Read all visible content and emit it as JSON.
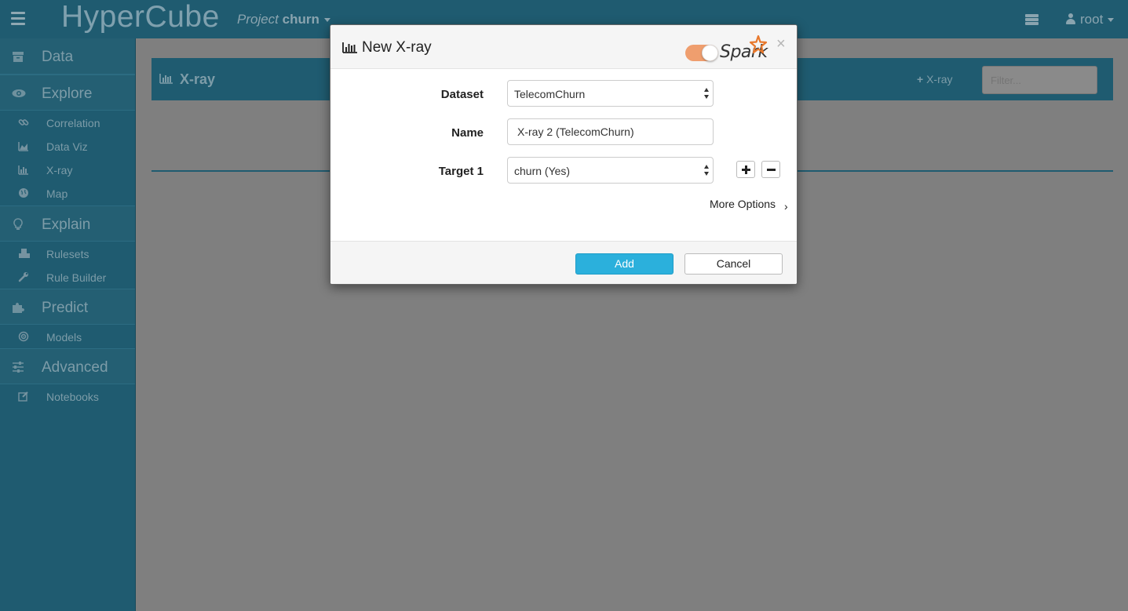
{
  "topbar": {
    "brand": "HyperCube",
    "project_prefix": "Project",
    "project_name": "churn",
    "user": "root"
  },
  "sidebar": {
    "sections": [
      {
        "label": "Data",
        "icon": "archive-icon"
      },
      {
        "label": "Explore",
        "icon": "eye-icon",
        "items": [
          {
            "label": "Correlation",
            "icon": "link-icon"
          },
          {
            "label": "Data Viz",
            "icon": "area-chart-icon"
          },
          {
            "label": "X-ray",
            "icon": "bar-chart-icon"
          },
          {
            "label": "Map",
            "icon": "globe-icon"
          }
        ]
      },
      {
        "label": "Explain",
        "icon": "lightbulb-icon",
        "items": [
          {
            "label": "Rulesets",
            "icon": "cubes-icon"
          },
          {
            "label": "Rule Builder",
            "icon": "wrench-icon"
          }
        ]
      },
      {
        "label": "Predict",
        "icon": "puzzle-icon",
        "items": [
          {
            "label": "Models",
            "icon": "bullseye-icon"
          }
        ]
      },
      {
        "label": "Advanced",
        "icon": "sliders-icon",
        "items": [
          {
            "label": "Notebooks",
            "icon": "edit-icon"
          }
        ]
      }
    ]
  },
  "main": {
    "title": "X-ray",
    "add_label": "X-ray",
    "filter_placeholder": "Filter..."
  },
  "modal": {
    "title": "New X-ray",
    "spark_label": "Spark",
    "spark_enabled": true,
    "close": "×",
    "dataset_label": "Dataset",
    "dataset_value": "TelecomChurn",
    "name_label": "Name",
    "name_value": "X-ray 2 (TelecomChurn)",
    "target_label": "Target 1",
    "target_value": "churn (Yes)",
    "more_options": "More Options",
    "add_button": "Add",
    "cancel_button": "Cancel"
  },
  "colors": {
    "nav_bg": "#1f5b70",
    "overlay": "#7f7f7f",
    "primary_button": "#2bb0dc",
    "spark_orange": "#ef9e6e"
  }
}
